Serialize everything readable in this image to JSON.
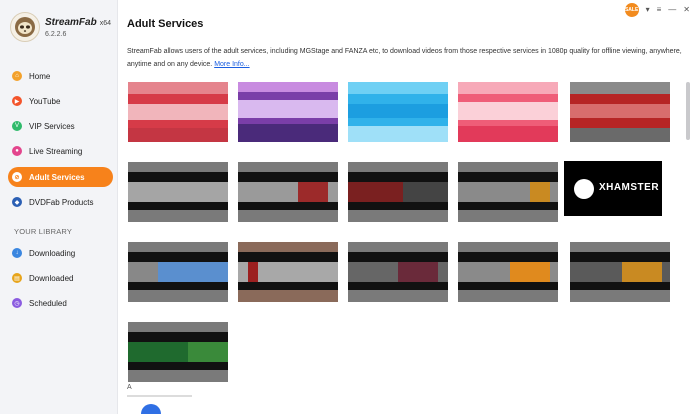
{
  "app": {
    "name": "StreamFab",
    "arch": "x64",
    "version": "6.2.2.6"
  },
  "top_controls": {
    "promo_badge": "SALE",
    "icons": [
      "promo-icon",
      "wifi-icon",
      "menu-icon",
      "minimize-icon",
      "close-icon"
    ],
    "minimize_glyph": "—",
    "menu_glyph": "≡",
    "wifi_glyph": "▾",
    "close_glyph": "✕"
  },
  "sidebar": {
    "items": [
      {
        "label": "Home",
        "icon": "home-icon",
        "color": "#f3a12b"
      },
      {
        "label": "YouTube",
        "icon": "youtube-icon",
        "color": "#f3542b"
      },
      {
        "label": "VIP Services",
        "icon": "vip-icon",
        "color": "#2fba6b"
      },
      {
        "label": "Live Streaming",
        "icon": "live-icon",
        "color": "#e3458d"
      },
      {
        "label": "Adult Services",
        "icon": "adult-icon",
        "color": "#f7821b",
        "active": true
      },
      {
        "label": "DVDFab Products",
        "icon": "dvdfab-icon",
        "color": "#2b5fb4"
      }
    ],
    "library_label": "YOUR LIBRARY",
    "library": [
      {
        "label": "Downloading",
        "icon": "download-icon",
        "color": "#3a86e0"
      },
      {
        "label": "Downloaded",
        "icon": "downloaded-icon",
        "color": "#e7a41b"
      },
      {
        "label": "Scheduled",
        "icon": "schedule-icon",
        "color": "#8a5be0"
      }
    ]
  },
  "main": {
    "title": "Adult Services",
    "description": "StreamFab allows users of the adult services, including MGStage and FANZA etc, to download videos from those respective services in 1080p quality for offline viewing, anywhere, anytime and on any device.",
    "more_link": "More Info...",
    "xhamster_label": "XHAMSTER",
    "stub_label": "A"
  },
  "colors": {
    "accent": "#f7821b",
    "link": "#1a5ee0"
  }
}
